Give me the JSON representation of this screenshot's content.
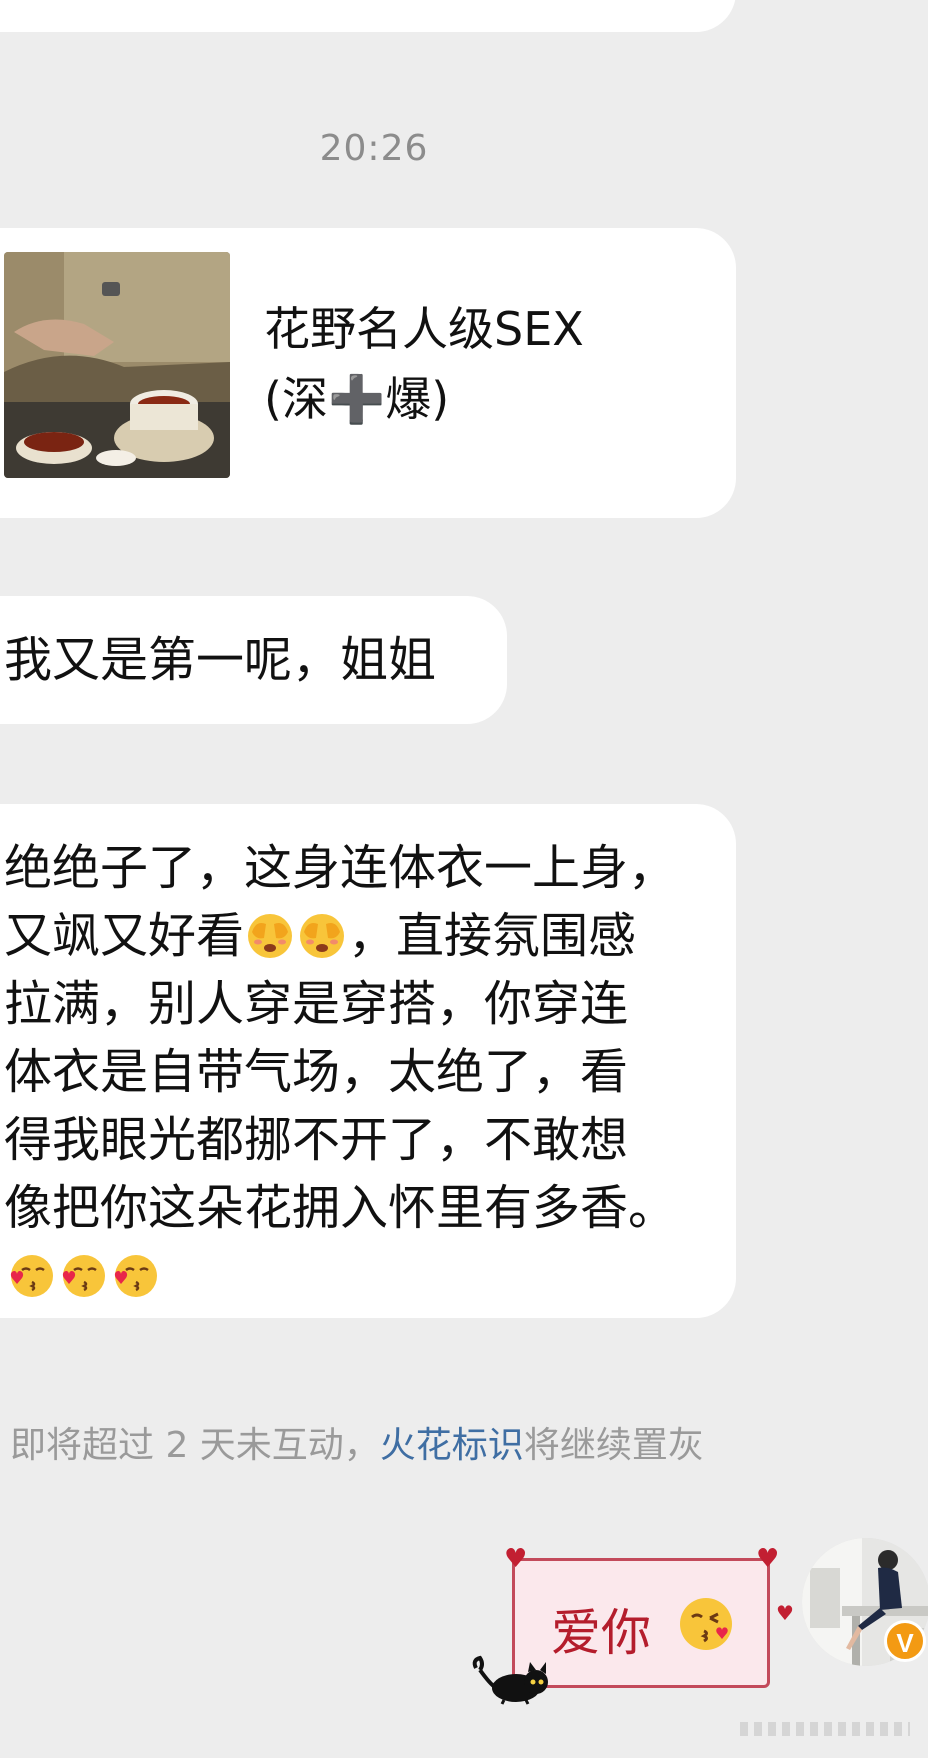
{
  "chat": {
    "timestamp": "20:26",
    "video_card": {
      "title": "花野名人级SEX\n(深➕爆)"
    },
    "message_short": "我又是第一呢，姐姐",
    "message_long": {
      "line1": "绝绝子了，这身连体衣一上身，",
      "line2_start": "又飒又好看",
      "line2_end": "，直接氛围感",
      "rest": "拉满，别人穿是穿搭，你穿连\n体衣是自带气场，太绝了，看\n得我眼光都挪不开了，不敢想\n像把你这朵花拥入怀里有多香。",
      "emoji_icons": [
        "peek-emoji",
        "peek-emoji",
        "kiss-heart-emoji",
        "kiss-heart-emoji",
        "kiss-heart-emoji"
      ]
    },
    "notice": {
      "before": "即将超过 2 天未互动，",
      "link": "火花标识",
      "after": "将继续置灰"
    },
    "sticker": {
      "text": "爱你",
      "emoji_icon": "blowing-kiss-emoji"
    },
    "avatar": {
      "badge": "V",
      "badge_color": "#f39a13"
    }
  },
  "colors": {
    "background": "#ededed",
    "bubble": "#ffffff",
    "link": "#3f6ea3",
    "sticker_border": "#c34a5b",
    "sticker_text": "#b41d2c"
  }
}
